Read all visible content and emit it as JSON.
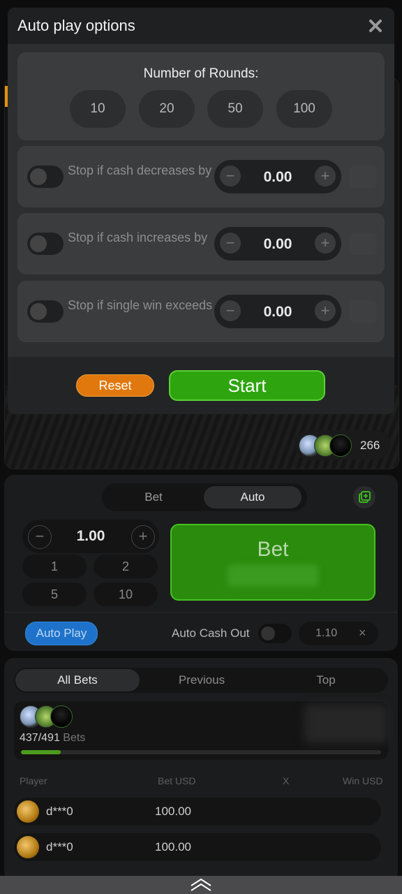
{
  "modal": {
    "title": "Auto play options",
    "close_icon": "close-icon",
    "rounds_label": "Number of Rounds:",
    "round_options": [
      "10",
      "20",
      "50",
      "100"
    ],
    "stop_conditions": [
      {
        "label": "Stop if cash decreases by",
        "value": "0.00",
        "enabled": false
      },
      {
        "label": "Stop if cash increases by",
        "value": "0.00",
        "enabled": false
      },
      {
        "label": "Stop if single win exceeds",
        "value": "0.00",
        "enabled": false
      }
    ],
    "minus_symbol": "−",
    "plus_symbol": "+",
    "reset_label": "Reset",
    "start_label": "Start",
    "colors": {
      "reset": "#e0780d",
      "start": "#2ea50f"
    }
  },
  "game": {
    "players_count": "266"
  },
  "bet_panel": {
    "tabs": [
      "Bet",
      "Auto"
    ],
    "active_tab": "Auto",
    "amount": "1.00",
    "minus_symbol": "−",
    "plus_symbol": "+",
    "quick_amounts": [
      "1",
      "2",
      "5",
      "10"
    ],
    "bet_button_label": "Bet",
    "auto_play_label": "Auto Play",
    "auto_cash_out_label": "Auto Cash Out",
    "auto_cash_out_enabled": false,
    "multiplier_value": "1.10",
    "clear_symbol": "×"
  },
  "bets_panel": {
    "tabs": [
      "All Bets",
      "Previous",
      "Top"
    ],
    "active_tab": "All Bets",
    "bets_count": "437/491",
    "bets_word": "Bets",
    "progress": 0.11,
    "columns": [
      "Player",
      "Bet USD",
      "X",
      "Win USD"
    ],
    "rows": [
      {
        "player": "d***0",
        "bet": "100.00"
      },
      {
        "player": "d***0",
        "bet": "100.00"
      }
    ]
  },
  "bottom_bar": {
    "icon": "chevron-up-icon"
  }
}
